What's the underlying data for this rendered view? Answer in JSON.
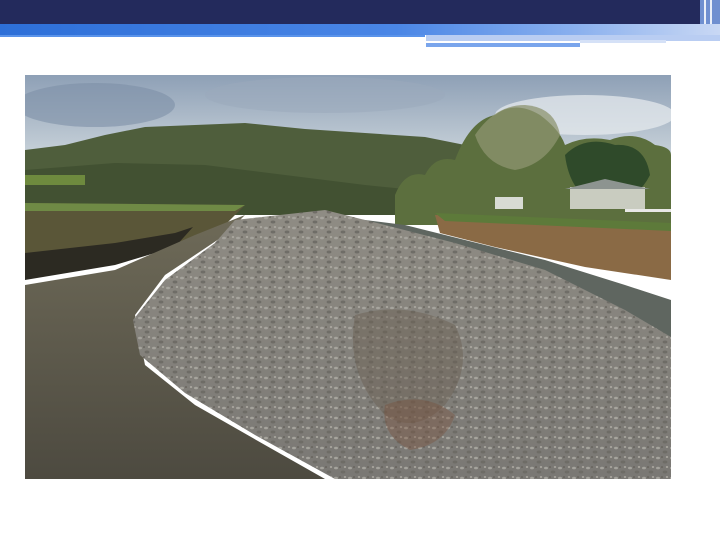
{
  "slide": {
    "photo": {
      "subject": "river-gravel-bar",
      "colors": {
        "sky": "#aab8c8",
        "hills": "#4b5a38",
        "water": "#5d5a4c",
        "gravel": "#8d8b86",
        "trees": "#58703a"
      }
    },
    "header": {
      "colors": {
        "bar": "#232a5c",
        "band": "#2d6fd8",
        "accent": "#8ab0ee"
      }
    }
  }
}
